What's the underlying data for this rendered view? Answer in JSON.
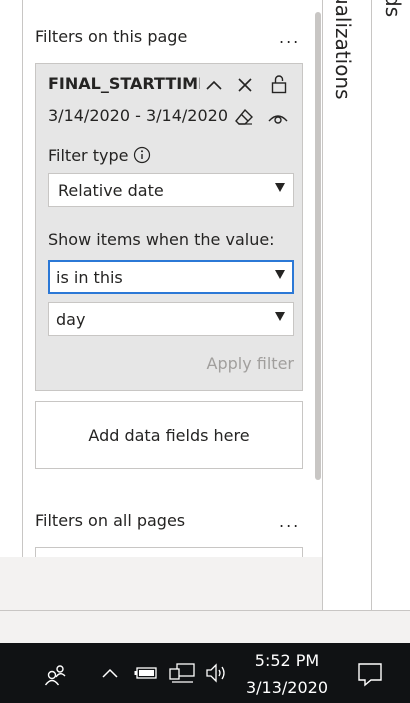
{
  "filter_pane": {
    "page_section_title": "Filters on this page",
    "all_pages_section_title": "Filters on all pages",
    "more_options": "...",
    "card": {
      "field_name": "FINAL_STARTTIMI",
      "date_range": "3/14/2020 - 3/14/2020",
      "filter_type_label": "Filter type",
      "filter_type_value": "Relative date",
      "show_items_label": "Show items when the value:",
      "condition_value": "is in this",
      "unit_value": "day",
      "apply_label": "Apply filter"
    },
    "add_fields_text": "Add data fields here"
  },
  "side_panes": {
    "visualizations_label": "ualizations",
    "fields_label": "ds"
  },
  "taskbar": {
    "time": "5:52 PM",
    "date": "3/13/2020"
  },
  "icons": [
    "collapse-chevron-icon",
    "clear-close-icon",
    "lock-icon",
    "eraser-icon",
    "eye-icon",
    "info-icon",
    "people-icon",
    "chevron-up-icon",
    "battery-icon",
    "network-icon",
    "volume-icon",
    "action-center-icon"
  ]
}
